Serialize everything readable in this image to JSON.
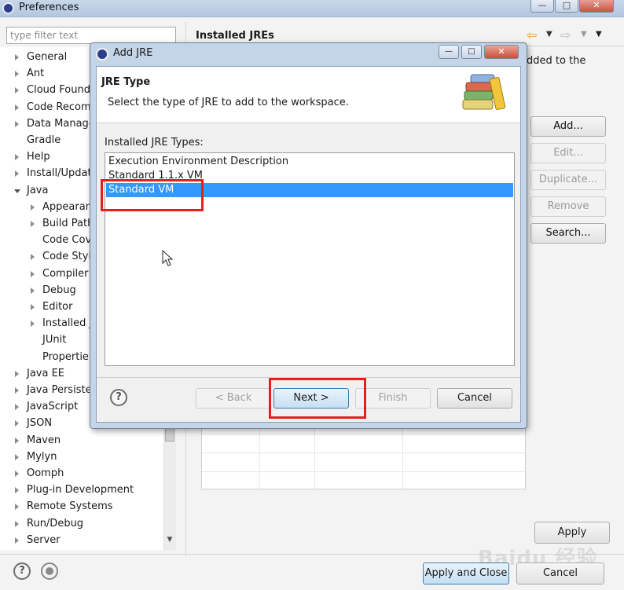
{
  "preferences": {
    "title": "Preferences",
    "filter_placeholder": "type filter text",
    "tree": [
      {
        "label": "General",
        "indent": 0,
        "expander": "right"
      },
      {
        "label": "Ant",
        "indent": 0,
        "expander": "right"
      },
      {
        "label": "Cloud Found",
        "indent": 0,
        "expander": "right"
      },
      {
        "label": "Code Recom",
        "indent": 0,
        "expander": "right"
      },
      {
        "label": "Data Manage",
        "indent": 0,
        "expander": "right"
      },
      {
        "label": "Gradle",
        "indent": 0,
        "expander": "none"
      },
      {
        "label": "Help",
        "indent": 0,
        "expander": "right"
      },
      {
        "label": "Install/Updat",
        "indent": 0,
        "expander": "right"
      },
      {
        "label": "Java",
        "indent": 0,
        "expander": "down"
      },
      {
        "label": "Appearan",
        "indent": 1,
        "expander": "right"
      },
      {
        "label": "Build Path",
        "indent": 1,
        "expander": "right"
      },
      {
        "label": "Code Cov",
        "indent": 1,
        "expander": "none"
      },
      {
        "label": "Code Styl",
        "indent": 1,
        "expander": "right"
      },
      {
        "label": "Compiler",
        "indent": 1,
        "expander": "right"
      },
      {
        "label": "Debug",
        "indent": 1,
        "expander": "right"
      },
      {
        "label": "Editor",
        "indent": 1,
        "expander": "right"
      },
      {
        "label": "Installed J",
        "indent": 1,
        "expander": "right"
      },
      {
        "label": "JUnit",
        "indent": 1,
        "expander": "none"
      },
      {
        "label": "Propertie",
        "indent": 1,
        "expander": "none"
      },
      {
        "label": "Java EE",
        "indent": 0,
        "expander": "right"
      },
      {
        "label": "Java Persiste",
        "indent": 0,
        "expander": "right"
      },
      {
        "label": "JavaScript",
        "indent": 0,
        "expander": "right"
      },
      {
        "label": "JSON",
        "indent": 0,
        "expander": "right"
      },
      {
        "label": "Maven",
        "indent": 0,
        "expander": "right"
      },
      {
        "label": "Mylyn",
        "indent": 0,
        "expander": "right"
      },
      {
        "label": "Oomph",
        "indent": 0,
        "expander": "right"
      },
      {
        "label": "Plug-in Development",
        "indent": 0,
        "expander": "right"
      },
      {
        "label": "Remote Systems",
        "indent": 0,
        "expander": "right"
      },
      {
        "label": "Run/Debug",
        "indent": 0,
        "expander": "right"
      },
      {
        "label": "Server",
        "indent": 0,
        "expander": "right"
      }
    ],
    "page_title": "Installed JREs",
    "page_desc_fragment": "dded to the",
    "side_buttons": {
      "add": "Add...",
      "edit": "Edit...",
      "duplicate": "Duplicate...",
      "remove": "Remove",
      "search": "Search..."
    },
    "apply_label": "Apply",
    "apply_close_label": "Apply and Close",
    "cancel_label": "Cancel",
    "help_glyph": "?",
    "watermark": "Baidu 经验"
  },
  "dialog": {
    "title": "Add JRE",
    "banner_title": "JRE Type",
    "banner_desc": "Select the type of JRE to add to the workspace.",
    "list_label": "Installed JRE Types:",
    "items": [
      {
        "label": "Execution Environment Description",
        "selected": false
      },
      {
        "label": "Standard 1.1.x VM",
        "selected": false
      },
      {
        "label": "Standard VM",
        "selected": true
      }
    ],
    "buttons": {
      "back": "< Back",
      "next": "Next >",
      "finish": "Finish",
      "cancel": "Cancel"
    },
    "help_glyph": "?"
  },
  "colors": {
    "selection": "#3399ff",
    "highlight": "#e81e1e"
  }
}
